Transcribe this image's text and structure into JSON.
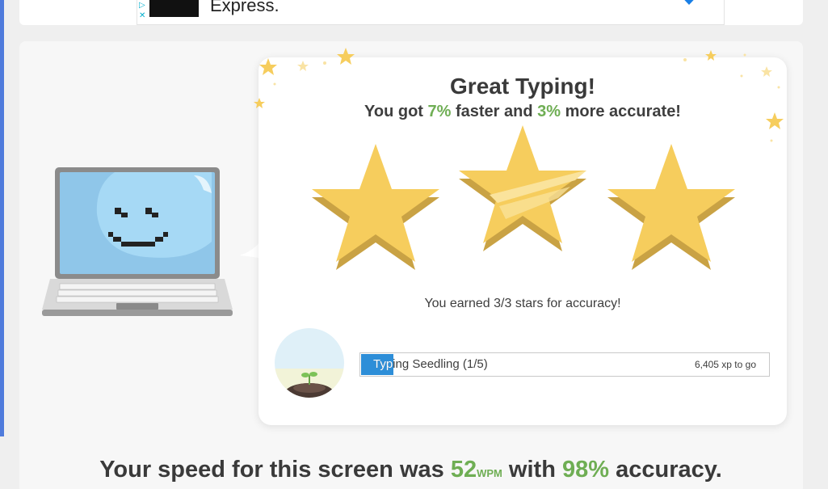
{
  "ad": {
    "choices_glyph": "▷",
    "close_glyph": "✕",
    "text": "Express.",
    "badge_color": "#1a7fe6"
  },
  "result": {
    "headline": "Great Typing!",
    "sub_prefix": "You got ",
    "speed_improvement": "7%",
    "sub_mid": " faster and ",
    "accuracy_improvement": "3%",
    "sub_suffix": " more accurate!",
    "stars_text": "You earned 3/3 stars for accuracy!",
    "stars_earned": 3,
    "stars_total": 3
  },
  "level": {
    "name": "Typing Seedling (1/5)",
    "xp_to_go": "6,405 xp to go",
    "progress_fraction": 0.08
  },
  "summary": {
    "prefix": "Your speed for this screen was ",
    "wpm": "52",
    "wpm_unit": "WPM",
    "mid": " with ",
    "accuracy": "98%",
    "suffix": " accuracy."
  },
  "colors": {
    "accent_green": "#6fae54",
    "progress_blue": "#2d8ed8",
    "star_gold": "#f6cd5d",
    "left_accent": "#4f7bdc"
  }
}
